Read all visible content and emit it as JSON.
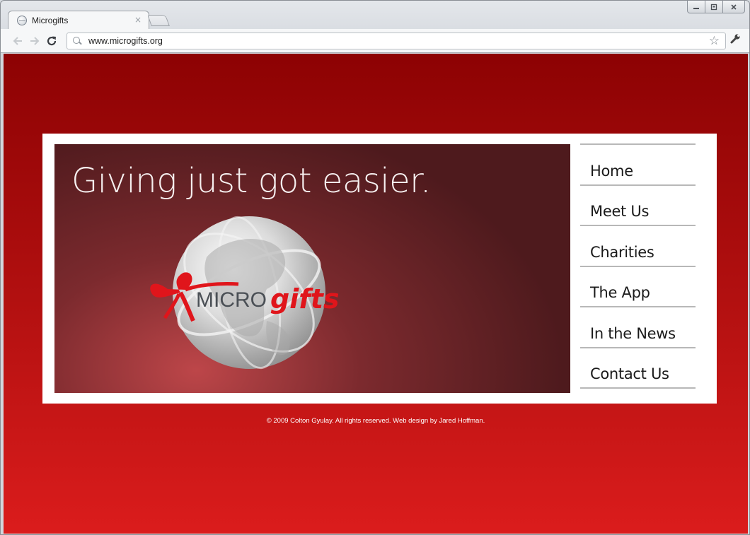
{
  "browser": {
    "tab_title": "Microgifts",
    "tab_close": "×",
    "url": "www.microgifts.org",
    "window_controls": [
      "minimize-icon",
      "maximize-icon",
      "close-icon"
    ],
    "nav_icons": [
      "back-arrow-icon",
      "forward-arrow-icon",
      "reload-icon"
    ]
  },
  "page": {
    "tagline": "Giving just got easier.",
    "logo": {
      "text_micro": "MICRO",
      "text_gifts": "gifts"
    },
    "nav": [
      {
        "label": "Home"
      },
      {
        "label": "Meet Us"
      },
      {
        "label": "Charities"
      },
      {
        "label": "The App"
      },
      {
        "label": "In the News"
      },
      {
        "label": "Contact Us"
      }
    ],
    "footer": "© 2009 Colton Gyulay. All rights reserved. Web design by Jared Hoffman."
  },
  "colors": {
    "page_background_top": "#8d0203",
    "page_background_bottom": "#db1c1c",
    "hero_background": "#4e1a1d",
    "ribbon_red": "#e0151b",
    "logo_gray": "#4a4f55"
  }
}
